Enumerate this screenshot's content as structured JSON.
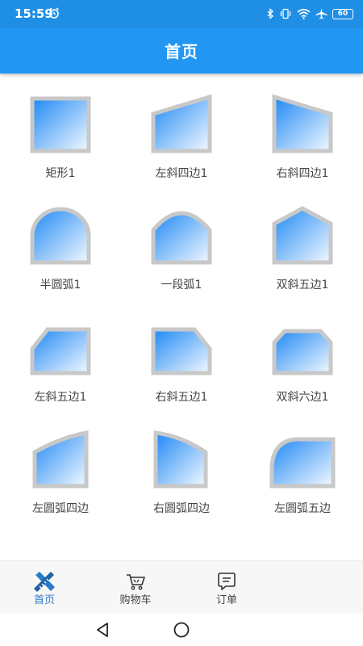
{
  "status": {
    "time": "15:59",
    "battery": "60"
  },
  "header": {
    "title": "首页"
  },
  "shapes": [
    {
      "label": "矩形1",
      "icon": "rectangle-window-icon"
    },
    {
      "label": "左斜四边1",
      "icon": "left-slant-quad-window-icon"
    },
    {
      "label": "右斜四边1",
      "icon": "right-slant-quad-window-icon"
    },
    {
      "label": "半圆弧1",
      "icon": "semicircle-arch-window-icon"
    },
    {
      "label": "一段弧1",
      "icon": "segment-arch-window-icon"
    },
    {
      "label": "双斜五边1",
      "icon": "double-slant-pentagon-window-icon"
    },
    {
      "label": "左斜五边1",
      "icon": "left-slant-pentagon-window-icon"
    },
    {
      "label": "右斜五边1",
      "icon": "right-slant-pentagon-window-icon"
    },
    {
      "label": "双斜六边1",
      "icon": "double-slant-hexagon-window-icon"
    },
    {
      "label": "左圆弧四边",
      "icon": "left-arc-quad-window-icon"
    },
    {
      "label": "右圆弧四边",
      "icon": "right-arc-quad-window-icon"
    },
    {
      "label": "左圆弧五边",
      "icon": "left-arc-pentagon-window-icon"
    }
  ],
  "bottom_nav": [
    {
      "label": "首页",
      "icon": "home-ruler-icon",
      "active": true
    },
    {
      "label": "购物车",
      "icon": "cart-icon",
      "active": false
    },
    {
      "label": "订单",
      "icon": "order-icon",
      "active": false
    }
  ],
  "colors": {
    "status_bar": "#1f8fe6",
    "app_bar": "#2196f3",
    "frame": "#c8c8c8",
    "glass_top": "#1e88f5",
    "glass_bottom": "#f4f9ff",
    "active_nav": "#2a7ac8"
  }
}
